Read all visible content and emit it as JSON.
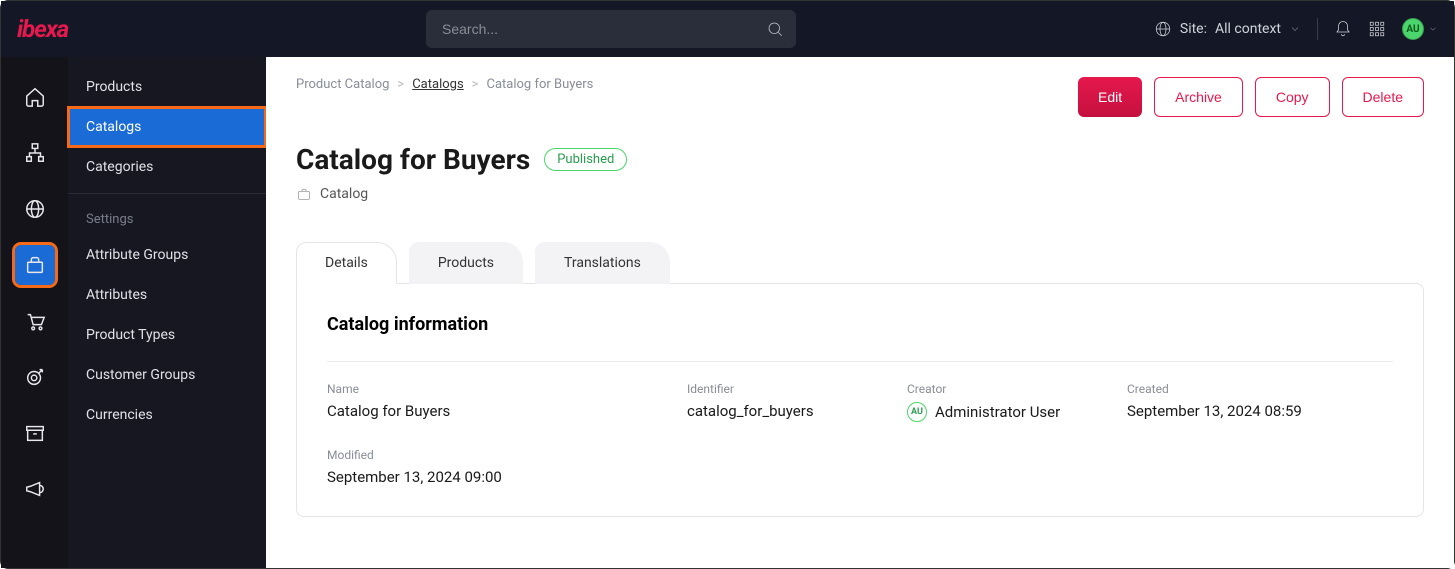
{
  "search": {
    "placeholder": "Search..."
  },
  "site_context": {
    "label": "Site:",
    "value": "All context"
  },
  "avatar_initials": "AU",
  "subnav": {
    "items": [
      "Products",
      "Catalogs",
      "Categories"
    ],
    "settings_header": "Settings",
    "settings_items": [
      "Attribute Groups",
      "Attributes",
      "Product Types",
      "Customer Groups",
      "Currencies"
    ]
  },
  "breadcrumbs": {
    "root": "Product Catalog",
    "parent": "Catalogs",
    "current": "Catalog for Buyers"
  },
  "actions": {
    "edit": "Edit",
    "archive": "Archive",
    "copy": "Copy",
    "delete": "Delete"
  },
  "page": {
    "title": "Catalog for Buyers",
    "status": "Published",
    "type": "Catalog"
  },
  "tabs": [
    "Details",
    "Products",
    "Translations"
  ],
  "panel": {
    "heading": "Catalog information",
    "fields": {
      "name_label": "Name",
      "name_value": "Catalog for Buyers",
      "identifier_label": "Identifier",
      "identifier_value": "catalog_for_buyers",
      "creator_label": "Creator",
      "creator_value": "Administrator User",
      "creator_initials": "AU",
      "created_label": "Created",
      "created_value": "September 13, 2024 08:59",
      "modified_label": "Modified",
      "modified_value": "September 13, 2024 09:00"
    }
  }
}
